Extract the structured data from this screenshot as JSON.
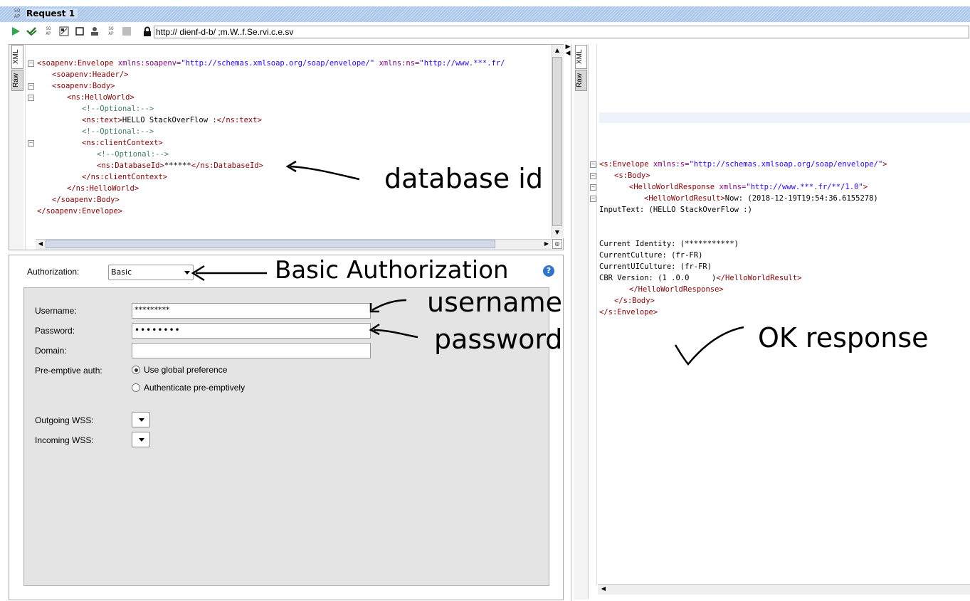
{
  "window": {
    "title": "Request 1",
    "soap_badge": "SO AP"
  },
  "toolbar": {
    "url": "http://                              dienf-d-b/         ;m.W..f.Se.rvi.c.e.sv"
  },
  "request_panel": {
    "tabs": [
      "XML",
      "Raw"
    ],
    "xml_lines": [
      {
        "indent": 0,
        "parts": [
          [
            "tag",
            "<soapenv:Envelope "
          ],
          [
            "attr",
            "xmlns:soapenv="
          ],
          [
            "val",
            "\"http://schemas.xmlsoap.org/soap/envelope/\" "
          ],
          [
            "attr",
            "xmlns:ns="
          ],
          [
            "val",
            "\"http://www.***.fr/"
          ]
        ]
      },
      {
        "indent": 1,
        "parts": [
          [
            "tag",
            "<soapenv:Header/>"
          ]
        ]
      },
      {
        "indent": 1,
        "parts": [
          [
            "tag",
            "<soapenv:Body>"
          ]
        ]
      },
      {
        "indent": 2,
        "parts": [
          [
            "tag",
            "<ns:HelloWorld>"
          ]
        ]
      },
      {
        "indent": 3,
        "parts": [
          [
            "cmt",
            "<!--Optional:-->"
          ]
        ]
      },
      {
        "indent": 3,
        "parts": [
          [
            "tag",
            "<ns:text>"
          ],
          [
            "txt",
            "HELLO StackOverFlow :"
          ],
          [
            "tag",
            "</ns:text>"
          ]
        ]
      },
      {
        "indent": 3,
        "parts": [
          [
            "cmt",
            "<!--Optional:-->"
          ]
        ]
      },
      {
        "indent": 3,
        "parts": [
          [
            "tag",
            "<ns:clientContext>"
          ]
        ]
      },
      {
        "indent": 4,
        "parts": [
          [
            "cmt",
            "<!--Optional:-->"
          ]
        ]
      },
      {
        "indent": 4,
        "parts": [
          [
            "tag",
            "<ns:DatabaseId>"
          ],
          [
            "txt",
            "******"
          ],
          [
            "tag",
            "</ns:DatabaseId>"
          ]
        ]
      },
      {
        "indent": 3,
        "parts": [
          [
            "tag",
            "</ns:clientContext>"
          ]
        ]
      },
      {
        "indent": 2,
        "parts": [
          [
            "tag",
            "</ns:HelloWorld>"
          ]
        ]
      },
      {
        "indent": 1,
        "parts": [
          [
            "tag",
            "</soapenv:Body>"
          ]
        ]
      },
      {
        "indent": 0,
        "parts": [
          [
            "tag",
            "</soapenv:Envelope>"
          ]
        ]
      }
    ],
    "annotation_database": "database id"
  },
  "auth_panel": {
    "authorization_label": "Authorization:",
    "authorization_value": "Basic",
    "help_glyph": "?",
    "annotation_basic": "Basic Authorization",
    "username_label": "Username:",
    "username_value": "*********",
    "password_label": "Password:",
    "password_value": "••••••••",
    "domain_label": "Domain:",
    "domain_value": "",
    "preemptive_label": "Pre-emptive auth:",
    "option_global": "Use global preference",
    "option_preemptive": "Authenticate pre-emptively",
    "outgoing_wss_label": "Outgoing WSS:",
    "incoming_wss_label": "Incoming WSS:",
    "annotation_username": "username",
    "annotation_password": "password"
  },
  "response_panel": {
    "tabs": [
      "XML",
      "Raw"
    ],
    "xml_lines": [
      {
        "indent": 0,
        "parts": [
          [
            "tag",
            "<s:Envelope "
          ],
          [
            "attr",
            "xmlns:s="
          ],
          [
            "val",
            "\"http://schemas.xmlsoap.org/soap/envelope/\""
          ],
          [
            "tag",
            ">"
          ]
        ]
      },
      {
        "indent": 1,
        "parts": [
          [
            "tag",
            "<s:Body>"
          ]
        ]
      },
      {
        "indent": 2,
        "parts": [
          [
            "tag",
            "<HelloWorldResponse "
          ],
          [
            "attr",
            "xmlns="
          ],
          [
            "val",
            "\"http://www.***.fr/**/1.0\""
          ],
          [
            "tag",
            ">"
          ]
        ]
      },
      {
        "indent": 3,
        "parts": [
          [
            "tag",
            "<HelloWorldResult>"
          ],
          [
            "txt",
            "Now: (2018-12-19T19:54:36.6155278)"
          ]
        ]
      },
      {
        "indent": 0,
        "parts": [
          [
            "txt",
            "InputText: (HELLO StackOverFlow :)"
          ]
        ]
      },
      {
        "indent": 0,
        "parts": [
          [
            "txt",
            ""
          ]
        ]
      },
      {
        "indent": 0,
        "parts": [
          [
            "txt",
            ""
          ]
        ]
      },
      {
        "indent": 0,
        "parts": [
          [
            "txt",
            "Current Identity: (***********)"
          ]
        ]
      },
      {
        "indent": 0,
        "parts": [
          [
            "txt",
            "CurrentCulture: (fr-FR)"
          ]
        ]
      },
      {
        "indent": 0,
        "parts": [
          [
            "txt",
            "CurrentUICulture: (fr-FR)"
          ]
        ]
      },
      {
        "indent": 0,
        "parts": [
          [
            "txt",
            "CBR Version: (1 .0.0     )"
          ],
          [
            "tag",
            "</HelloWorldResult>"
          ]
        ]
      },
      {
        "indent": 2,
        "parts": [
          [
            "tag",
            "</HelloWorldResponse>"
          ]
        ]
      },
      {
        "indent": 1,
        "parts": [
          [
            "tag",
            "</s:Body>"
          ]
        ]
      },
      {
        "indent": 0,
        "parts": [
          [
            "tag",
            "</s:Envelope>"
          ]
        ]
      }
    ],
    "annotation_ok": "OK response"
  }
}
